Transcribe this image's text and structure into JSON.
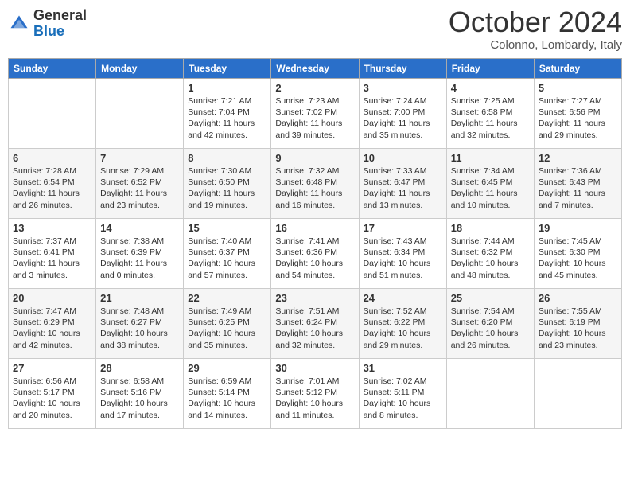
{
  "logo": {
    "general": "General",
    "blue": "Blue"
  },
  "header": {
    "month": "October 2024",
    "location": "Colonno, Lombardy, Italy"
  },
  "weekdays": [
    "Sunday",
    "Monday",
    "Tuesday",
    "Wednesday",
    "Thursday",
    "Friday",
    "Saturday"
  ],
  "weeks": [
    [
      {
        "day": "",
        "info": ""
      },
      {
        "day": "",
        "info": ""
      },
      {
        "day": "1",
        "info": "Sunrise: 7:21 AM\nSunset: 7:04 PM\nDaylight: 11 hours and 42 minutes."
      },
      {
        "day": "2",
        "info": "Sunrise: 7:23 AM\nSunset: 7:02 PM\nDaylight: 11 hours and 39 minutes."
      },
      {
        "day": "3",
        "info": "Sunrise: 7:24 AM\nSunset: 7:00 PM\nDaylight: 11 hours and 35 minutes."
      },
      {
        "day": "4",
        "info": "Sunrise: 7:25 AM\nSunset: 6:58 PM\nDaylight: 11 hours and 32 minutes."
      },
      {
        "day": "5",
        "info": "Sunrise: 7:27 AM\nSunset: 6:56 PM\nDaylight: 11 hours and 29 minutes."
      }
    ],
    [
      {
        "day": "6",
        "info": "Sunrise: 7:28 AM\nSunset: 6:54 PM\nDaylight: 11 hours and 26 minutes."
      },
      {
        "day": "7",
        "info": "Sunrise: 7:29 AM\nSunset: 6:52 PM\nDaylight: 11 hours and 23 minutes."
      },
      {
        "day": "8",
        "info": "Sunrise: 7:30 AM\nSunset: 6:50 PM\nDaylight: 11 hours and 19 minutes."
      },
      {
        "day": "9",
        "info": "Sunrise: 7:32 AM\nSunset: 6:48 PM\nDaylight: 11 hours and 16 minutes."
      },
      {
        "day": "10",
        "info": "Sunrise: 7:33 AM\nSunset: 6:47 PM\nDaylight: 11 hours and 13 minutes."
      },
      {
        "day": "11",
        "info": "Sunrise: 7:34 AM\nSunset: 6:45 PM\nDaylight: 11 hours and 10 minutes."
      },
      {
        "day": "12",
        "info": "Sunrise: 7:36 AM\nSunset: 6:43 PM\nDaylight: 11 hours and 7 minutes."
      }
    ],
    [
      {
        "day": "13",
        "info": "Sunrise: 7:37 AM\nSunset: 6:41 PM\nDaylight: 11 hours and 3 minutes."
      },
      {
        "day": "14",
        "info": "Sunrise: 7:38 AM\nSunset: 6:39 PM\nDaylight: 11 hours and 0 minutes."
      },
      {
        "day": "15",
        "info": "Sunrise: 7:40 AM\nSunset: 6:37 PM\nDaylight: 10 hours and 57 minutes."
      },
      {
        "day": "16",
        "info": "Sunrise: 7:41 AM\nSunset: 6:36 PM\nDaylight: 10 hours and 54 minutes."
      },
      {
        "day": "17",
        "info": "Sunrise: 7:43 AM\nSunset: 6:34 PM\nDaylight: 10 hours and 51 minutes."
      },
      {
        "day": "18",
        "info": "Sunrise: 7:44 AM\nSunset: 6:32 PM\nDaylight: 10 hours and 48 minutes."
      },
      {
        "day": "19",
        "info": "Sunrise: 7:45 AM\nSunset: 6:30 PM\nDaylight: 10 hours and 45 minutes."
      }
    ],
    [
      {
        "day": "20",
        "info": "Sunrise: 7:47 AM\nSunset: 6:29 PM\nDaylight: 10 hours and 42 minutes."
      },
      {
        "day": "21",
        "info": "Sunrise: 7:48 AM\nSunset: 6:27 PM\nDaylight: 10 hours and 38 minutes."
      },
      {
        "day": "22",
        "info": "Sunrise: 7:49 AM\nSunset: 6:25 PM\nDaylight: 10 hours and 35 minutes."
      },
      {
        "day": "23",
        "info": "Sunrise: 7:51 AM\nSunset: 6:24 PM\nDaylight: 10 hours and 32 minutes."
      },
      {
        "day": "24",
        "info": "Sunrise: 7:52 AM\nSunset: 6:22 PM\nDaylight: 10 hours and 29 minutes."
      },
      {
        "day": "25",
        "info": "Sunrise: 7:54 AM\nSunset: 6:20 PM\nDaylight: 10 hours and 26 minutes."
      },
      {
        "day": "26",
        "info": "Sunrise: 7:55 AM\nSunset: 6:19 PM\nDaylight: 10 hours and 23 minutes."
      }
    ],
    [
      {
        "day": "27",
        "info": "Sunrise: 6:56 AM\nSunset: 5:17 PM\nDaylight: 10 hours and 20 minutes."
      },
      {
        "day": "28",
        "info": "Sunrise: 6:58 AM\nSunset: 5:16 PM\nDaylight: 10 hours and 17 minutes."
      },
      {
        "day": "29",
        "info": "Sunrise: 6:59 AM\nSunset: 5:14 PM\nDaylight: 10 hours and 14 minutes."
      },
      {
        "day": "30",
        "info": "Sunrise: 7:01 AM\nSunset: 5:12 PM\nDaylight: 10 hours and 11 minutes."
      },
      {
        "day": "31",
        "info": "Sunrise: 7:02 AM\nSunset: 5:11 PM\nDaylight: 10 hours and 8 minutes."
      },
      {
        "day": "",
        "info": ""
      },
      {
        "day": "",
        "info": ""
      }
    ]
  ]
}
